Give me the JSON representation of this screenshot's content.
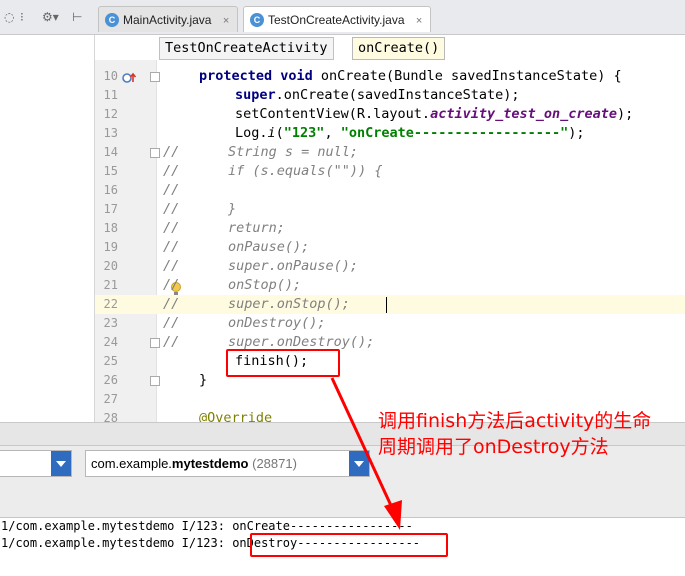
{
  "tabs": [
    {
      "label": "MainActivity.java",
      "close": "×",
      "icon_letter": "C"
    },
    {
      "label": "TestOnCreateActivity.java",
      "close": "×",
      "icon_letter": "C"
    }
  ],
  "toolbar": {
    "tool1": "⚙▾",
    "tool2": "⁝"
  },
  "breadcrumb": {
    "class_name": "TestOnCreateActivity",
    "method_name": "onCreate()"
  },
  "code_lines": [
    {
      "n": "10",
      "text": "protected void onCreate(Bundle savedInstanceState) {"
    },
    {
      "n": "11",
      "text": "super.onCreate(savedInstanceState);"
    },
    {
      "n": "12",
      "text": "setContentView(R.layout.activity_test_on_create);"
    },
    {
      "n": "13",
      "text": "Log.i(\"123\", \"onCreate------------------\");"
    },
    {
      "n": "14",
      "text": "//      String s = null;"
    },
    {
      "n": "15",
      "text": "//      if (s.equals(\"\")) {"
    },
    {
      "n": "16",
      "text": "//"
    },
    {
      "n": "17",
      "text": "//      }"
    },
    {
      "n": "18",
      "text": "//      return;"
    },
    {
      "n": "19",
      "text": "//      onPause();"
    },
    {
      "n": "20",
      "text": "//      super.onPause();"
    },
    {
      "n": "21",
      "text": "//      onStop();"
    },
    {
      "n": "22",
      "text": "//      super.onStop();"
    },
    {
      "n": "23",
      "text": "//      onDestroy();"
    },
    {
      "n": "24",
      "text": "//      super.onDestroy();"
    },
    {
      "n": "25",
      "text": "finish();"
    },
    {
      "n": "26",
      "text": "}"
    },
    {
      "n": "27",
      "text": ""
    },
    {
      "n": "28",
      "text": "@Override"
    }
  ],
  "logcat": {
    "process_package": "com.example.",
    "process_name": "mytestdemo",
    "process_pid": "(28871)",
    "lines": [
      "1/com.example.mytestdemo I/123: onCreate-----------------",
      "1/com.example.mytestdemo I/123: onDestroy-----------------"
    ]
  },
  "annotation": {
    "line1": "调用finish方法后activity的生命",
    "line2": "周期调用了onDestroy方法"
  },
  "colors": {
    "annotation_red": "#ff0000",
    "keyword": "#000080",
    "string": "#008000",
    "comment": "#808080"
  }
}
